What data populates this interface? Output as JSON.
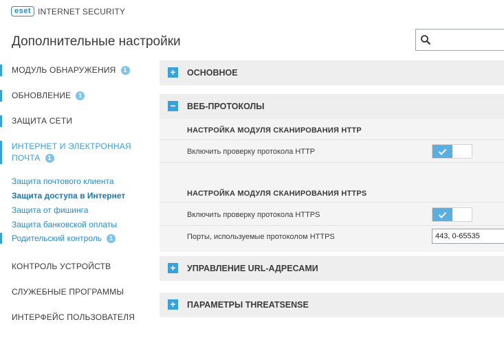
{
  "header": {
    "logo": "eset",
    "product": "INTERNET SECURITY",
    "title": "Дополнительные настройки",
    "search_icon": "search-icon"
  },
  "sidebar": {
    "items": [
      {
        "label": "МОДУЛЬ ОБНАРУЖЕНИЯ",
        "badge": "1"
      },
      {
        "label": "ОБНОВЛЕНИЕ",
        "badge": "1"
      },
      {
        "label": "ЗАЩИТА СЕТИ"
      },
      {
        "label_line1": "ИНТЕРНЕТ И ЭЛЕКТРОННАЯ",
        "label_line2": "ПОЧТА",
        "badge": "1"
      },
      {
        "label": "КОНТРОЛЬ УСТРОЙСТВ"
      },
      {
        "label": "СЛУЖЕБНЫЕ ПРОГРАММЫ"
      },
      {
        "label": "ИНТЕРФЕЙС ПОЛЬЗОВАТЕЛЯ"
      }
    ],
    "subitems": [
      {
        "label": "Защита почтового клиента"
      },
      {
        "label": "Защита доступа в Интернет"
      },
      {
        "label": "Защита от фишинга"
      },
      {
        "label": "Защита банковской оплаты"
      },
      {
        "label": "Родительский контроль",
        "badge": "1"
      }
    ]
  },
  "content": {
    "sections": [
      {
        "title": "ОСНОВНОЕ",
        "icon": "+"
      },
      {
        "title": "ВЕБ-ПРОТОКОЛЫ",
        "icon": "−"
      },
      {
        "title": "УПРАВЛЕНИЕ URL-АДРЕСАМИ",
        "icon": "+"
      },
      {
        "title": "ПАРАМЕТРЫ THREATSENSE",
        "icon": "+"
      }
    ],
    "http": {
      "heading": "НАСТРОЙКА МОДУЛЯ СКАНИРОВАНИЯ HTTP",
      "enable_label": "Включить проверку протокола HTTP",
      "enabled": true
    },
    "https": {
      "heading": "НАСТРОЙКА МОДУЛЯ СКАНИРОВАНИЯ HTTPS",
      "enable_label": "Включить проверку протокола HTTPS",
      "enabled": true,
      "ports_label": "Порты, используемые протоколом HTTPS",
      "ports_value": "443, 0-65535"
    }
  },
  "colors": {
    "accent": "#3aa0d8",
    "badge": "#7ec3ea",
    "section_bg": "#eeeeee"
  }
}
